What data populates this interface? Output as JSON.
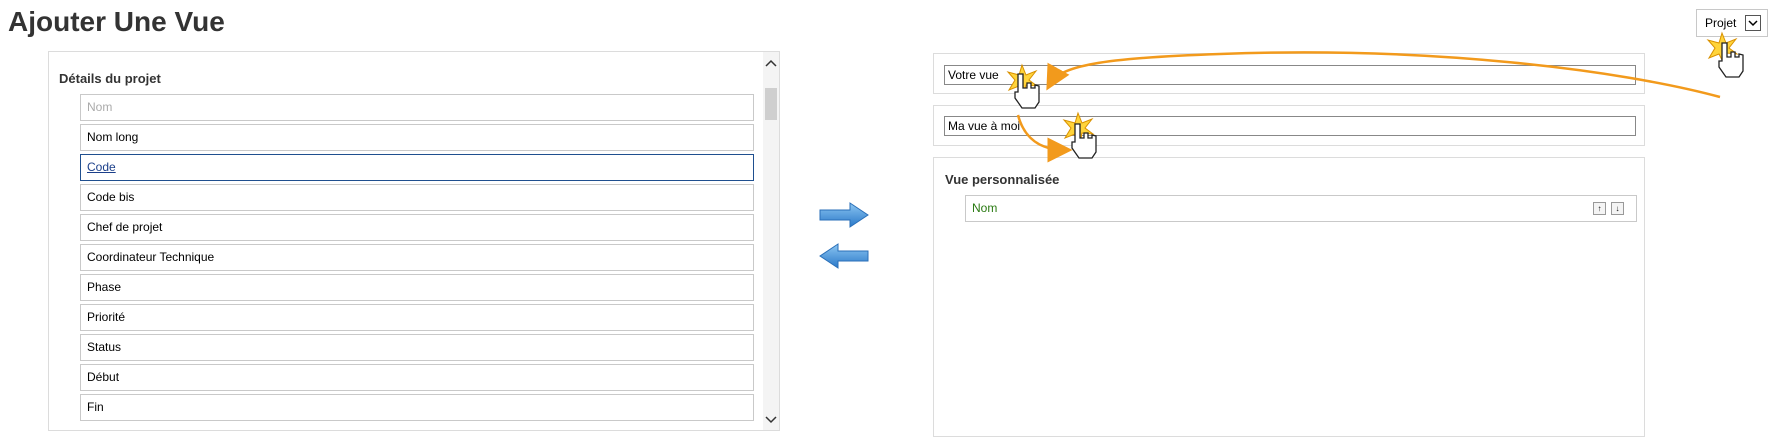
{
  "page": {
    "title": "Ajouter Une Vue"
  },
  "project_selector": {
    "label": "Projet",
    "dropdown_icon": "chevron-down-icon"
  },
  "details_panel": {
    "title": "Détails du projet",
    "fields": [
      {
        "label": "Nom",
        "state": "placeholder"
      },
      {
        "label": "Nom long",
        "state": "normal"
      },
      {
        "label": "Code",
        "state": "selected"
      },
      {
        "label": "Code bis",
        "state": "normal"
      },
      {
        "label": "Chef de projet",
        "state": "normal"
      },
      {
        "label": "Coordinateur Technique",
        "state": "normal"
      },
      {
        "label": "Phase",
        "state": "normal"
      },
      {
        "label": "Priorité",
        "state": "normal"
      },
      {
        "label": "Status",
        "state": "normal"
      },
      {
        "label": "Début",
        "state": "normal"
      },
      {
        "label": "Fin",
        "state": "normal"
      }
    ]
  },
  "transfer": {
    "add_icon": "arrow-right-icon",
    "remove_icon": "arrow-left-icon",
    "color": "#3b8fd8"
  },
  "view_name": {
    "value": "Votre vue"
  },
  "view_label": {
    "value": "Ma vue à moi"
  },
  "custom_view": {
    "title": "Vue personnalisée",
    "items": [
      {
        "label": "Nom",
        "up_icon": "arrow-up-icon",
        "down_icon": "arrow-down-icon"
      }
    ]
  },
  "tutorial": {
    "pointer_icon": "hand-pointer-icon",
    "click_burst_icon": "click-burst-icon",
    "accent": "#f29a1c"
  }
}
